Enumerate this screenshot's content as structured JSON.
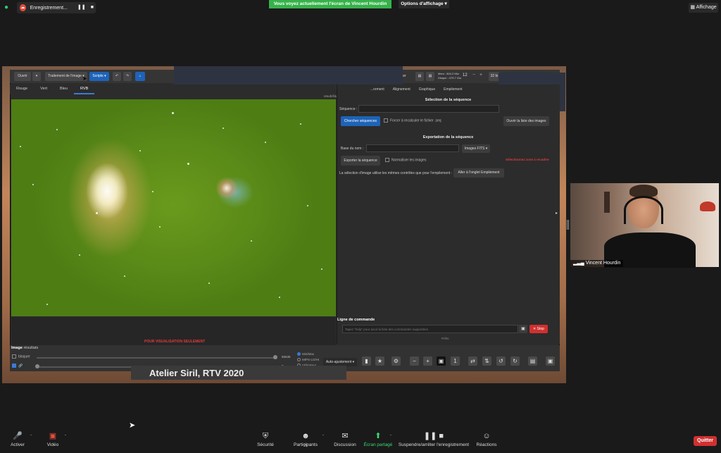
{
  "top": {
    "recording_label": "Enregistrement...",
    "share_banner": "Vous voyez actuellement l'écran de Vincent Hourdin",
    "view_options": "Options d'affichage",
    "display_label": "Affichage"
  },
  "toolbar": {
    "open": "Ouvrir",
    "processing": "Traitement de l'image",
    "scripts": "Scripts",
    "stop_short": "rter",
    "mem": "Mem : 804.2 Mio",
    "disk": "Disque : 479.7 Gio",
    "threads": "12",
    "bits": "32 bi"
  },
  "channel_tabs": [
    "Rouge",
    "Vert",
    "Bleu",
    "RVB"
  ],
  "image_title": "result.fits",
  "right_panel": {
    "tabs": [
      "...",
      "...rement",
      "Alignement",
      "Graphique",
      "Empilement"
    ],
    "sequence_section": "Sélection de la séquence",
    "sequence_label": "Séquence :",
    "search_button": "Chercher séquences",
    "force_recalc": "Forcer à recalculer le fichier .seq",
    "open_image_list": "Ouvrir la liste des images",
    "export_section": "Exportation de la séquence",
    "base_name_label": "Base du nom :",
    "format_select": "Images FITS",
    "export_button": "Exporter la séquence",
    "normalize": "Normaliser les images",
    "selection_warning": "Sélectionnez zone à recadrer",
    "selection_note": "La sélection d'image utilise les mêmes contrôles que pour l'empilement :",
    "goto_stacking": "Aller à l'onglet Empilement",
    "cmd_label": "Ligne de commande",
    "cmd_placeholder": "Tapez \"help\" pour avoir la liste des commandes supportées",
    "stop_button": "Stop",
    "status": "Prêts"
  },
  "image_panel": {
    "vis_only": "POUR VISUALISATION SEULEMENT",
    "results_bold": "Image",
    "results_rest": "résultats",
    "lock": "bloquer",
    "max_value": "65535",
    "min_value": "0",
    "radios": [
      "Min/Max",
      "MIPS-LO/HI",
      "Utilisateur"
    ],
    "auto_adjust": "Auto-ajustement"
  },
  "overlay_text": "Atelier Siril, RTV 2020",
  "video": {
    "name": "Vincent Hourdin"
  },
  "bottom_bar": {
    "unmute": "Activer",
    "video": "Vidéo",
    "security": "Sécurité",
    "participants": "Participants",
    "participants_count": "27",
    "chat": "Discussion",
    "share": "Écran partagé",
    "recording": "Suspendre/arrêter l'enregistrement",
    "reactions": "Réactions",
    "quit": "Quitter"
  },
  "colors": {
    "accent_blue": "#1e63b8",
    "share_green": "#36b24a",
    "stop_red": "#d03030"
  }
}
